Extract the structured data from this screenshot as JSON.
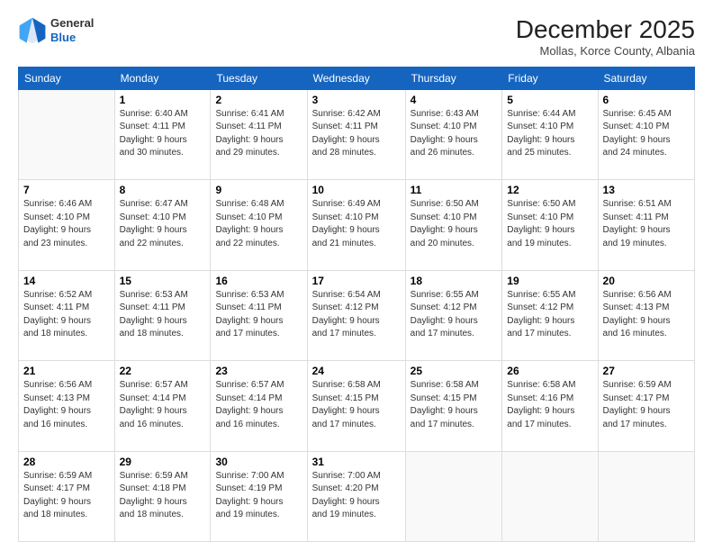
{
  "header": {
    "logo": {
      "line1": "General",
      "line2": "Blue"
    },
    "title": "December 2025",
    "location": "Mollas, Korce County, Albania"
  },
  "weekdays": [
    "Sunday",
    "Monday",
    "Tuesday",
    "Wednesday",
    "Thursday",
    "Friday",
    "Saturday"
  ],
  "weeks": [
    [
      {
        "day": "",
        "info": ""
      },
      {
        "day": "1",
        "info": "Sunrise: 6:40 AM\nSunset: 4:11 PM\nDaylight: 9 hours\nand 30 minutes."
      },
      {
        "day": "2",
        "info": "Sunrise: 6:41 AM\nSunset: 4:11 PM\nDaylight: 9 hours\nand 29 minutes."
      },
      {
        "day": "3",
        "info": "Sunrise: 6:42 AM\nSunset: 4:11 PM\nDaylight: 9 hours\nand 28 minutes."
      },
      {
        "day": "4",
        "info": "Sunrise: 6:43 AM\nSunset: 4:10 PM\nDaylight: 9 hours\nand 26 minutes."
      },
      {
        "day": "5",
        "info": "Sunrise: 6:44 AM\nSunset: 4:10 PM\nDaylight: 9 hours\nand 25 minutes."
      },
      {
        "day": "6",
        "info": "Sunrise: 6:45 AM\nSunset: 4:10 PM\nDaylight: 9 hours\nand 24 minutes."
      }
    ],
    [
      {
        "day": "7",
        "info": "Sunrise: 6:46 AM\nSunset: 4:10 PM\nDaylight: 9 hours\nand 23 minutes."
      },
      {
        "day": "8",
        "info": "Sunrise: 6:47 AM\nSunset: 4:10 PM\nDaylight: 9 hours\nand 22 minutes."
      },
      {
        "day": "9",
        "info": "Sunrise: 6:48 AM\nSunset: 4:10 PM\nDaylight: 9 hours\nand 22 minutes."
      },
      {
        "day": "10",
        "info": "Sunrise: 6:49 AM\nSunset: 4:10 PM\nDaylight: 9 hours\nand 21 minutes."
      },
      {
        "day": "11",
        "info": "Sunrise: 6:50 AM\nSunset: 4:10 PM\nDaylight: 9 hours\nand 20 minutes."
      },
      {
        "day": "12",
        "info": "Sunrise: 6:50 AM\nSunset: 4:10 PM\nDaylight: 9 hours\nand 19 minutes."
      },
      {
        "day": "13",
        "info": "Sunrise: 6:51 AM\nSunset: 4:11 PM\nDaylight: 9 hours\nand 19 minutes."
      }
    ],
    [
      {
        "day": "14",
        "info": "Sunrise: 6:52 AM\nSunset: 4:11 PM\nDaylight: 9 hours\nand 18 minutes."
      },
      {
        "day": "15",
        "info": "Sunrise: 6:53 AM\nSunset: 4:11 PM\nDaylight: 9 hours\nand 18 minutes."
      },
      {
        "day": "16",
        "info": "Sunrise: 6:53 AM\nSunset: 4:11 PM\nDaylight: 9 hours\nand 17 minutes."
      },
      {
        "day": "17",
        "info": "Sunrise: 6:54 AM\nSunset: 4:12 PM\nDaylight: 9 hours\nand 17 minutes."
      },
      {
        "day": "18",
        "info": "Sunrise: 6:55 AM\nSunset: 4:12 PM\nDaylight: 9 hours\nand 17 minutes."
      },
      {
        "day": "19",
        "info": "Sunrise: 6:55 AM\nSunset: 4:12 PM\nDaylight: 9 hours\nand 17 minutes."
      },
      {
        "day": "20",
        "info": "Sunrise: 6:56 AM\nSunset: 4:13 PM\nDaylight: 9 hours\nand 16 minutes."
      }
    ],
    [
      {
        "day": "21",
        "info": "Sunrise: 6:56 AM\nSunset: 4:13 PM\nDaylight: 9 hours\nand 16 minutes."
      },
      {
        "day": "22",
        "info": "Sunrise: 6:57 AM\nSunset: 4:14 PM\nDaylight: 9 hours\nand 16 minutes."
      },
      {
        "day": "23",
        "info": "Sunrise: 6:57 AM\nSunset: 4:14 PM\nDaylight: 9 hours\nand 16 minutes."
      },
      {
        "day": "24",
        "info": "Sunrise: 6:58 AM\nSunset: 4:15 PM\nDaylight: 9 hours\nand 17 minutes."
      },
      {
        "day": "25",
        "info": "Sunrise: 6:58 AM\nSunset: 4:15 PM\nDaylight: 9 hours\nand 17 minutes."
      },
      {
        "day": "26",
        "info": "Sunrise: 6:58 AM\nSunset: 4:16 PM\nDaylight: 9 hours\nand 17 minutes."
      },
      {
        "day": "27",
        "info": "Sunrise: 6:59 AM\nSunset: 4:17 PM\nDaylight: 9 hours\nand 17 minutes."
      }
    ],
    [
      {
        "day": "28",
        "info": "Sunrise: 6:59 AM\nSunset: 4:17 PM\nDaylight: 9 hours\nand 18 minutes."
      },
      {
        "day": "29",
        "info": "Sunrise: 6:59 AM\nSunset: 4:18 PM\nDaylight: 9 hours\nand 18 minutes."
      },
      {
        "day": "30",
        "info": "Sunrise: 7:00 AM\nSunset: 4:19 PM\nDaylight: 9 hours\nand 19 minutes."
      },
      {
        "day": "31",
        "info": "Sunrise: 7:00 AM\nSunset: 4:20 PM\nDaylight: 9 hours\nand 19 minutes."
      },
      {
        "day": "",
        "info": ""
      },
      {
        "day": "",
        "info": ""
      },
      {
        "day": "",
        "info": ""
      }
    ]
  ]
}
